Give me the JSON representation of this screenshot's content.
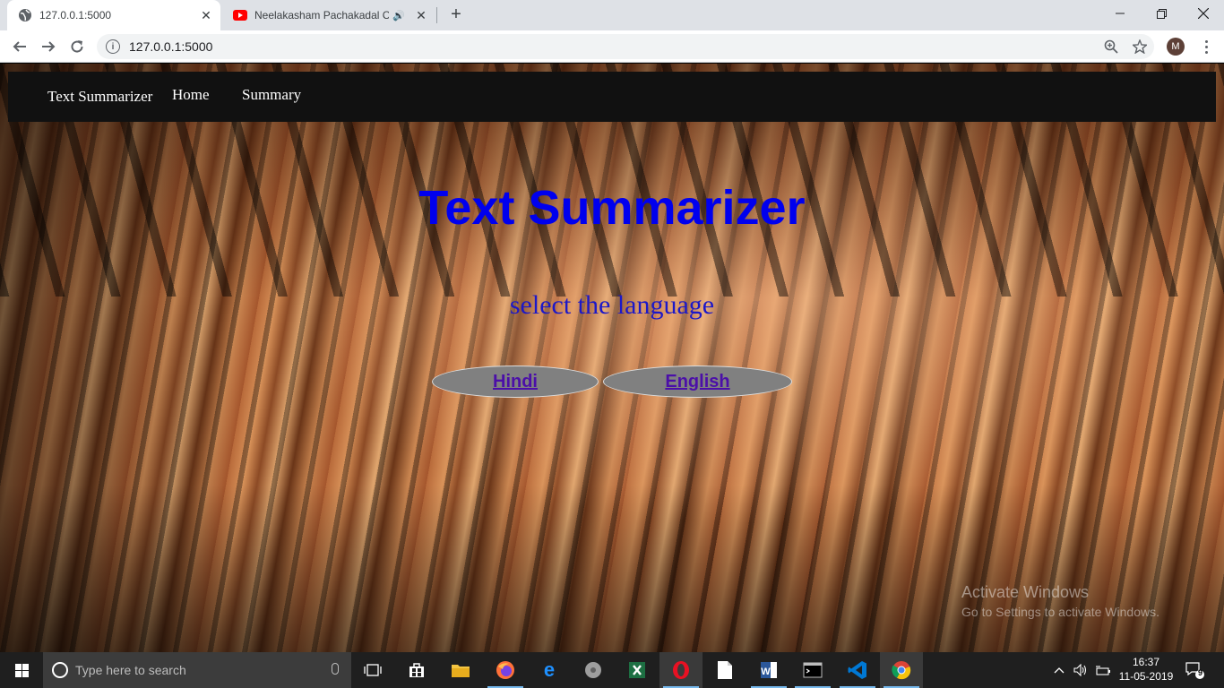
{
  "browser": {
    "tabs": [
      {
        "title": "127.0.0.1:5000",
        "active": true
      },
      {
        "title": "Neelakasham Pachakadal Ch",
        "active": false,
        "audio": true
      }
    ],
    "url": "127.0.0.1:5000",
    "profile_initial": "M"
  },
  "site": {
    "nav": {
      "brand": "Text Summarizer",
      "links": [
        "Home",
        "Summary"
      ]
    },
    "title": "Text Summarizer",
    "subtitle": "select the language",
    "languages": [
      "Hindi",
      "English"
    ],
    "colors": {
      "title": "#0000ee",
      "subtitle": "#1c18c8",
      "button_bg": "#808080",
      "button_text": "#4b0fa8",
      "nav_bg": "#111111"
    }
  },
  "watermark": {
    "line1": "Activate Windows",
    "line2": "Go to Settings to activate Windows."
  },
  "taskbar": {
    "search_placeholder": "Type here to search",
    "apps": [
      "task-view",
      "microsoft-store",
      "file-explorer",
      "firefox",
      "edge",
      "media-player",
      "excel",
      "opera",
      "notepad",
      "word",
      "terminal",
      "vscode",
      "chrome"
    ],
    "time": "16:37",
    "date": "11-05-2019",
    "notification_count": "9"
  }
}
